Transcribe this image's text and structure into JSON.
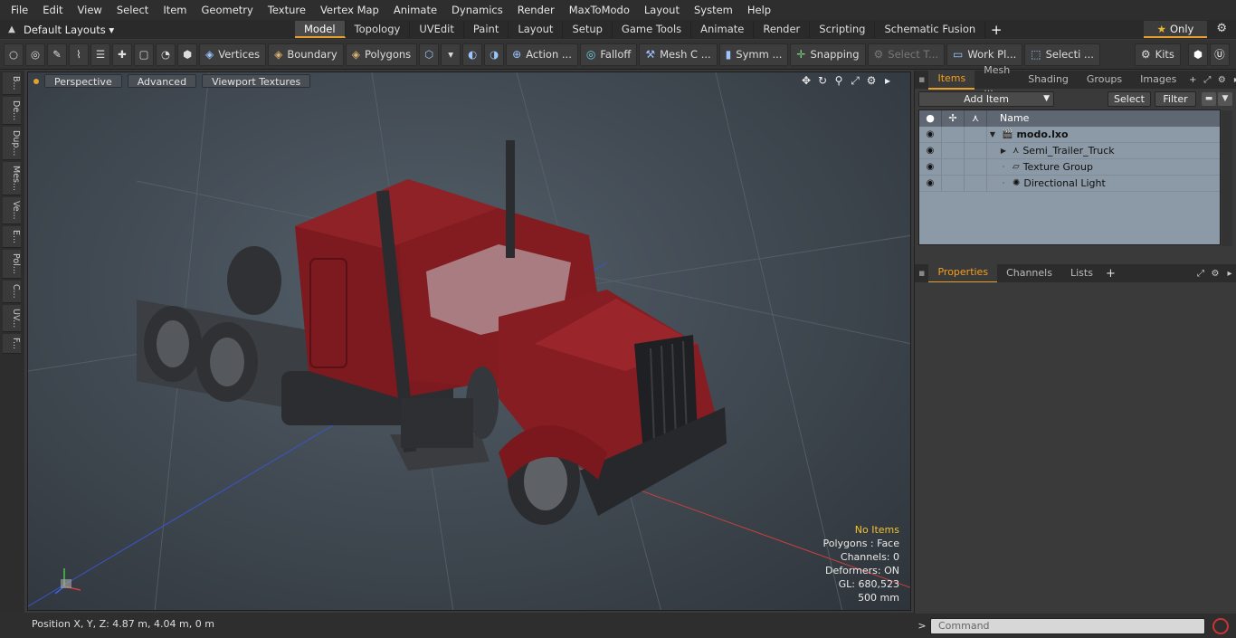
{
  "menu": [
    "File",
    "Edit",
    "View",
    "Select",
    "Item",
    "Geometry",
    "Texture",
    "Vertex Map",
    "Animate",
    "Dynamics",
    "Render",
    "MaxToModo",
    "Layout",
    "System",
    "Help"
  ],
  "layout": {
    "layouts_label": "Default Layouts ▾",
    "tabs": [
      "Model",
      "Topology",
      "UVEdit",
      "Paint",
      "Layout",
      "Setup",
      "Game Tools",
      "Animate",
      "Render",
      "Scripting",
      "Schematic Fusion"
    ],
    "active_tab": "Model",
    "only_label": "Only"
  },
  "toolbar": {
    "vertices": "Vertices",
    "boundary": "Boundary",
    "polygons": "Polygons",
    "action": "Action ...",
    "falloff": "Falloff",
    "meshc": "Mesh C ...",
    "symm": "Symm ...",
    "snapping": "Snapping",
    "selectt": "Select T...",
    "workpl": "Work Pl...",
    "selecti": "Selecti ...",
    "kits": "Kits"
  },
  "lefttabs": [
    "B...",
    "De...",
    "Dup...",
    "Mes...",
    "Ve...",
    "E...",
    "Pol...",
    "C...",
    "UV...",
    "F..."
  ],
  "viewport": {
    "perspective": "Perspective",
    "advanced": "Advanced",
    "textures": "Viewport Textures",
    "info": {
      "no_items": "No Items",
      "polygons": "Polygons : Face",
      "channels": "Channels: 0",
      "deformers": "Deformers: ON",
      "gl": "GL: 680,523",
      "scale": "500 mm"
    }
  },
  "status": {
    "position": "Position X, Y, Z:   4.87 m, 4.04 m, 0 m"
  },
  "right": {
    "tabs": [
      "Items",
      "Mesh ...",
      "Shading",
      "Groups",
      "Images"
    ],
    "active_tab": "Items",
    "add_item": "Add Item",
    "select": "Select",
    "filter": "Filter",
    "name_col": "Name",
    "tree": [
      {
        "label": "modo.lxo",
        "bold": true
      },
      {
        "label": "Semi_Trailer_Truck"
      },
      {
        "label": "Texture Group"
      },
      {
        "label": "Directional Light"
      }
    ],
    "prop_tabs": [
      "Properties",
      "Channels",
      "Lists"
    ],
    "active_prop_tab": "Properties"
  },
  "command": {
    "placeholder": "Command"
  },
  "colors": {
    "accent": "#e8a02c",
    "truck_red": "#8a1a1e",
    "tree_bg": "#8c99a6"
  }
}
